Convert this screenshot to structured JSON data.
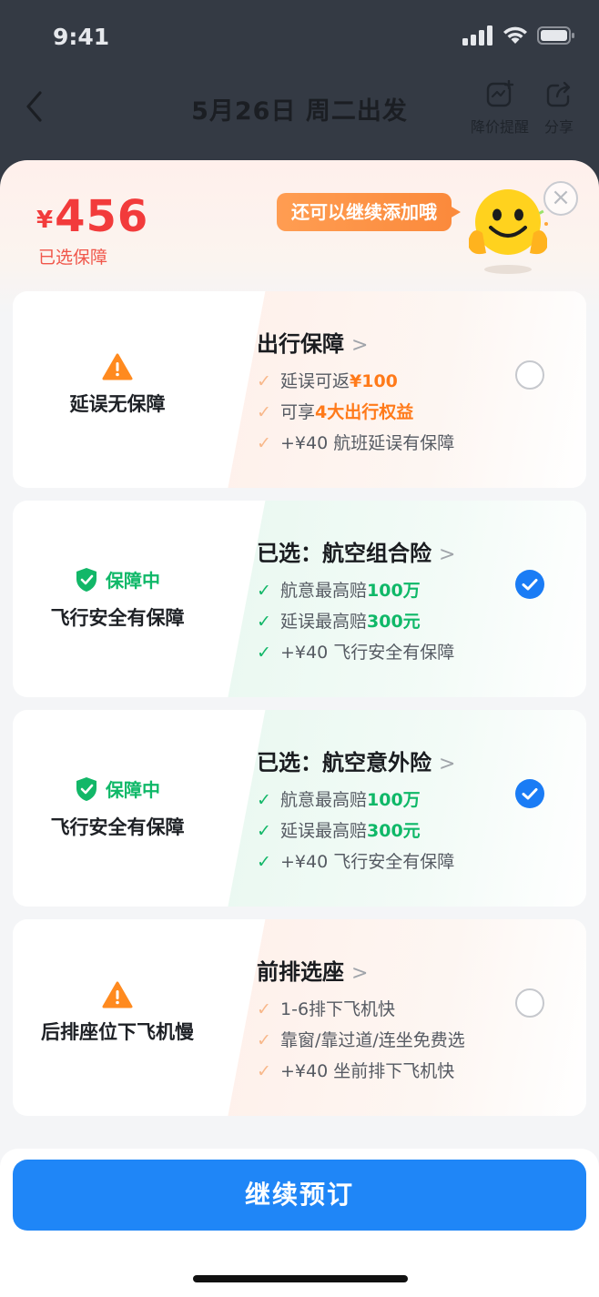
{
  "status_bar": {
    "time": "9:41"
  },
  "nav": {
    "title": "5月26日 周二出发",
    "price_alert_label": "降价提醒",
    "share_label": "分享"
  },
  "summary": {
    "currency": "¥",
    "price": "456",
    "subtitle": "已选保障",
    "bubble": "还可以继续添加哦"
  },
  "cards": [
    {
      "state": "warn",
      "left_label": "延误无保障",
      "title": "出行保障",
      "features": [
        {
          "pre": "延误可返",
          "hl": "¥100",
          "post": ""
        },
        {
          "pre": "可享",
          "hl": "4大出行权益",
          "post": ""
        },
        {
          "pre": "+¥40 航班延误有保障",
          "hl": "",
          "post": ""
        }
      ],
      "checked": false
    },
    {
      "state": "ok",
      "status": "保障中",
      "left_label": "飞行安全有保障",
      "title": "已选：航空组合险",
      "features": [
        {
          "pre": "航意最高赔",
          "hl": "100万",
          "post": ""
        },
        {
          "pre": "延误最高赔",
          "hl": "300元",
          "post": ""
        },
        {
          "pre": "+¥40 飞行安全有保障",
          "hl": "",
          "post": ""
        }
      ],
      "checked": true
    },
    {
      "state": "ok",
      "status": "保障中",
      "left_label": "飞行安全有保障",
      "title": "已选：航空意外险",
      "features": [
        {
          "pre": "航意最高赔",
          "hl": "100万",
          "post": ""
        },
        {
          "pre": "延误最高赔",
          "hl": "300元",
          "post": ""
        },
        {
          "pre": "+¥40 飞行安全有保障",
          "hl": "",
          "post": ""
        }
      ],
      "checked": true
    },
    {
      "state": "warn",
      "left_label": "后排座位下飞机慢",
      "title": "前排选座",
      "features": [
        {
          "pre": "1-6排下飞机快",
          "hl": "",
          "post": ""
        },
        {
          "pre": "靠窗/靠过道/连坐免费选",
          "hl": "",
          "post": ""
        },
        {
          "pre": "+¥40 坐前排下飞机快",
          "hl": "",
          "post": ""
        }
      ],
      "checked": false
    }
  ],
  "cta_label": "继续预订",
  "colors": {
    "accent_blue": "#1f86f7",
    "price_red": "#f23b3b",
    "ok_green": "#0fb868",
    "warn_orange": "#ff7a1a"
  }
}
